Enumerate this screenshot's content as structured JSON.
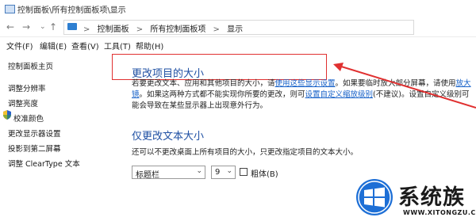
{
  "window": {
    "title": "控制面板\\所有控制面板项\\显示"
  },
  "address": {
    "nav_back": "←",
    "nav_forward": "→",
    "nav_up": "↑",
    "crumbs": [
      "控制面板",
      "所有控制面板项",
      "显示"
    ],
    "separator": ">"
  },
  "menu": [
    "文件(F)",
    "编辑(E)",
    "查看(V)",
    "工具(T)",
    "帮助(H)"
  ],
  "sidebar": {
    "home": "控制面板主页",
    "items": [
      "调整分辨率",
      "调整亮度",
      "校准颜色",
      "更改显示器设置",
      "投影到第二屏幕",
      "调整 ClearType 文本"
    ]
  },
  "main": {
    "heading1": "更改项目的大小",
    "para1_a": "若要更改文本、应用和其他项目的大小，请",
    "para1_link1": "使用这些显示设置",
    "para1_b": "。如果要临时放大部分屏幕，请使用",
    "para1_link2": "放大镜",
    "para1_c": "。如果这两种方式都不能实现你所要的更改，则可",
    "para1_link3": "设置自定义缩放级别",
    "para1_d": "(不建议)。设置自定义级别可能会导致在某些显示器上出现意外行为。",
    "heading2": "仅更改文本大小",
    "para2": "还可以不更改桌面上所有项目的大小，只更改指定项目的文本大小。",
    "element_select": "标题栏",
    "size_select": "9",
    "bold_label": "粗体(B)"
  },
  "watermark": {
    "text": "系统族",
    "url": "WWW.XITONGZU.COM"
  },
  "colors": {
    "heading": "#1e4fa3",
    "link": "#1560c8",
    "annotation": "#e03030"
  }
}
